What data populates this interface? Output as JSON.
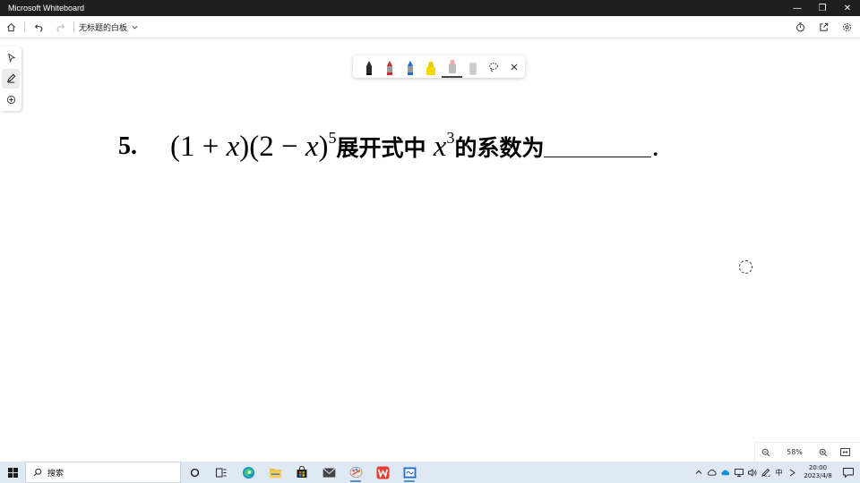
{
  "window": {
    "title": "Microsoft Whiteboard",
    "controls": [
      "—",
      "❐",
      "✕"
    ]
  },
  "toolbar": {
    "doc_title": "无标题的白板"
  },
  "canvas": {
    "question_number": "5.",
    "expr_part1": "(1 + ",
    "expr_x1": "x",
    "expr_part2": ")(2 − ",
    "expr_x2": "x",
    "expr_part3": ")",
    "exponent1": "5",
    "text_mid": "展开式中",
    "expr_x3": "x",
    "exponent2": "3",
    "text_end": "的系数为",
    "period": "."
  },
  "pen_tray": {
    "pens": [
      {
        "name": "black-pen",
        "color": "#222222"
      },
      {
        "name": "red-pen",
        "color": "#d9262c"
      },
      {
        "name": "blue-pen",
        "color": "#1f6fd1"
      },
      {
        "name": "yellow-highlighter",
        "color": "#f5d800"
      },
      {
        "name": "pink-highlighter",
        "color": "#f2a7b3"
      },
      {
        "name": "eraser",
        "color": "#d0d0d0"
      }
    ]
  },
  "zoom": {
    "level": "58%"
  },
  "taskbar": {
    "search_placeholder": "搜索",
    "ime": "中",
    "time": "20:00",
    "date": "2023/4/8"
  }
}
